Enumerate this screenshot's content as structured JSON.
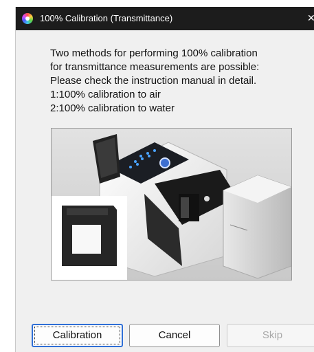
{
  "window": {
    "title": "100% Calibration (Transmittance)",
    "close_glyph": "✕"
  },
  "message": {
    "lines": [
      "Two methods for performing 100% calibration",
      "for transmittance measurements are possible:",
      "Please check the instruction manual in detail.",
      "1:100% calibration to air",
      "2:100% calibration to water"
    ]
  },
  "buttons": {
    "calibration": "Calibration",
    "cancel": "Cancel",
    "skip": "Skip"
  },
  "icons": {
    "app": "color-wheel-icon",
    "close": "close-icon"
  }
}
